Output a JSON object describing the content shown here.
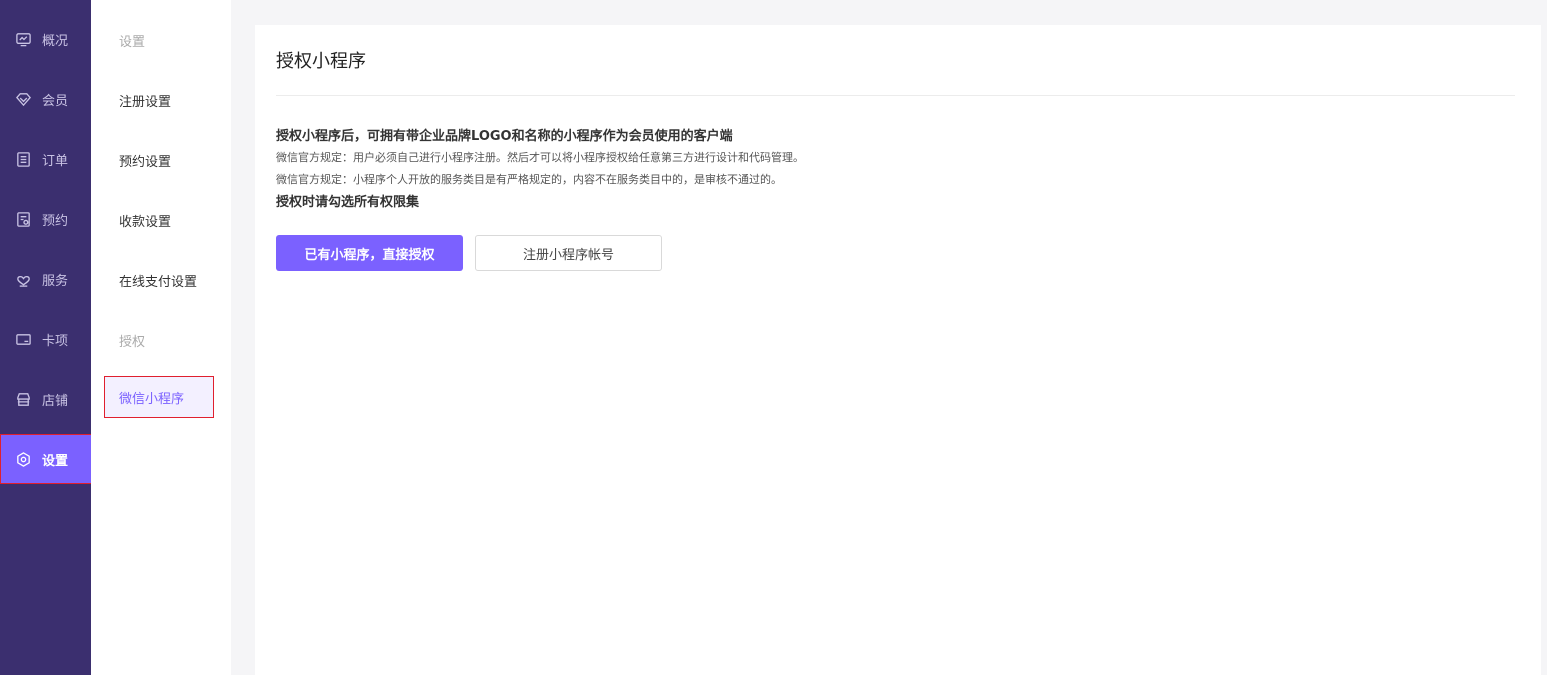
{
  "nav": {
    "items": [
      {
        "label": "概况",
        "icon": "monitor-icon"
      },
      {
        "label": "会员",
        "icon": "diamond-icon"
      },
      {
        "label": "订单",
        "icon": "list-icon"
      },
      {
        "label": "预约",
        "icon": "calendar-icon"
      },
      {
        "label": "服务",
        "icon": "heart-hand-icon"
      },
      {
        "label": "卡项",
        "icon": "card-icon"
      },
      {
        "label": "店铺",
        "icon": "store-icon"
      },
      {
        "label": "设置",
        "icon": "settings-icon",
        "active": true
      }
    ]
  },
  "subnav": {
    "group_settings": "设置",
    "register_settings": "注册设置",
    "booking_settings": "预约设置",
    "payment_settings": "收款设置",
    "online_payment_settings": "在线支付设置",
    "group_auth": "授权",
    "wechat_miniprogram": "微信小程序"
  },
  "content": {
    "title": "授权小程序",
    "info_heading": "授权小程序后，可拥有带企业品牌LOGO和名称的小程序作为会员使用的客户端",
    "rule_1": "微信官方规定：用户必须自己进行小程序注册。然后才可以将小程序授权给任意第三方进行设计和代码管理。",
    "rule_2": "微信官方规定：小程序个人开放的服务类目是有严格规定的，内容不在服务类目中的，是审核不通过的。",
    "info_footer": "授权时请勾选所有权限集",
    "primary_button": "已有小程序，直接授权",
    "secondary_button": "注册小程序帐号"
  },
  "colors": {
    "sidebar_bg": "#3b2f6f",
    "accent": "#7b61ff",
    "highlight_outline": "#e0202e"
  }
}
